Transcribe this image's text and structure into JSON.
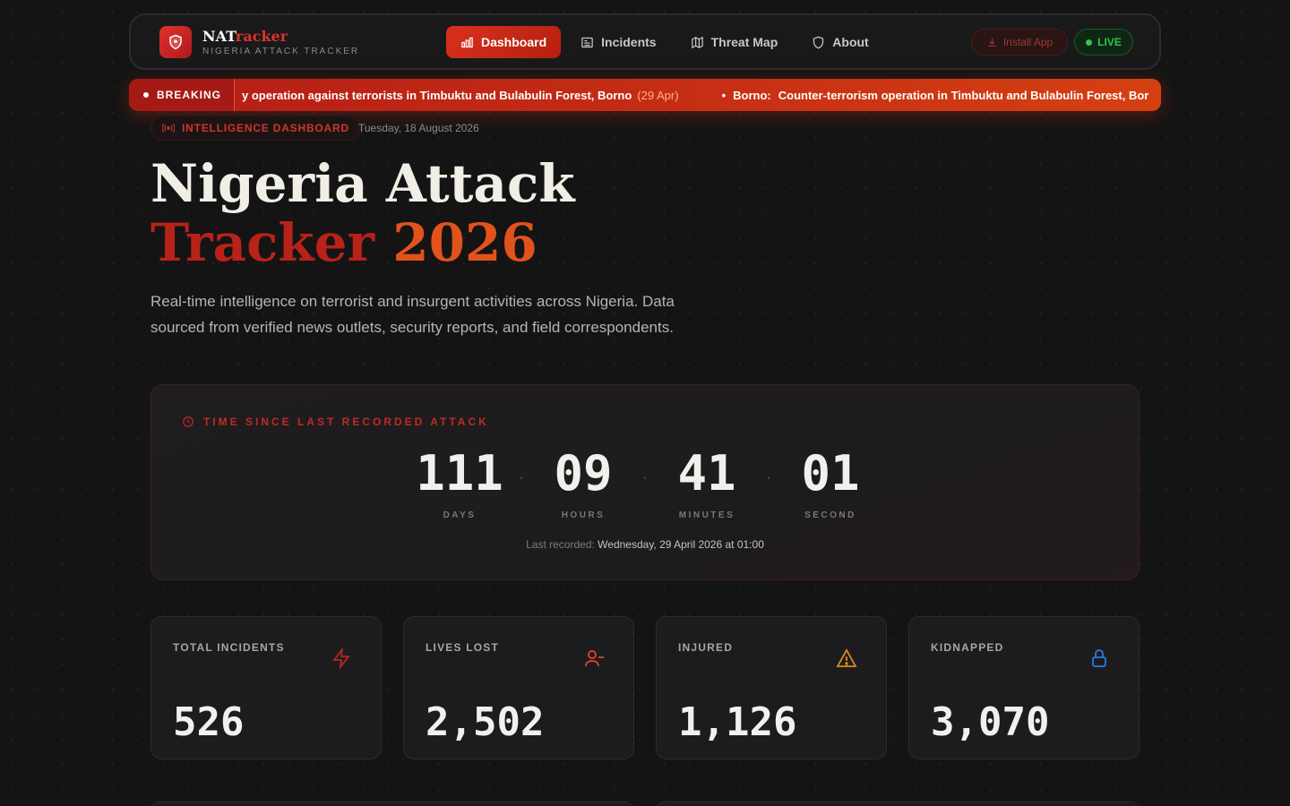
{
  "brand": {
    "name_part1": "NAT",
    "name_part2": "racker",
    "subtitle": "NIGERIA ATTACK TRACKER"
  },
  "nav": {
    "links": [
      {
        "label": "Dashboard",
        "icon": "bar-chart-icon",
        "active": true
      },
      {
        "label": "Incidents",
        "icon": "newspaper-icon",
        "active": false
      },
      {
        "label": "Threat Map",
        "icon": "map-icon",
        "active": false
      },
      {
        "label": "About",
        "icon": "shield-icon",
        "active": false
      }
    ],
    "install_label": "Install App",
    "live_label": "LIVE"
  },
  "ticker": {
    "label": "BREAKING",
    "items": [
      {
        "text": "y operation against terrorists in Timbuktu and Bulabulin Forest, Borno",
        "date": "(29 Apr)"
      },
      {
        "location": "Borno:",
        "text": "Counter-terrorism operation in Timbuktu and Bulabulin Forest, Bor"
      }
    ]
  },
  "hero": {
    "pill": "INTELLIGENCE DASHBOARD",
    "date": "Tuesday, 18 August 2026",
    "title_line1": "Nigeria Attack",
    "title_word1": "Tracker",
    "title_word2": "2026",
    "description": "Real-time intelligence on terrorist and insurgent activities across Nigeria. Data sourced from verified news outlets, security reports, and field correspondents."
  },
  "countdown": {
    "label": "TIME SINCE LAST RECORDED ATTACK",
    "units": [
      {
        "value": "111",
        "name": "DAYS"
      },
      {
        "value": "09",
        "name": "HOURS"
      },
      {
        "value": "41",
        "name": "MINUTES"
      },
      {
        "value": "01",
        "name": "SECOND"
      }
    ],
    "last_prefix": "Last recorded:",
    "last_value": "Wednesday, 29 April 2026 at 01:00"
  },
  "stats": [
    {
      "label": "TOTAL INCIDENTS",
      "value": "526",
      "icon": "lightning-icon",
      "color": "#b8261f"
    },
    {
      "label": "LIVES LOST",
      "value": "2,502",
      "icon": "user-minus-icon",
      "color": "#e0442c"
    },
    {
      "label": "INJURED",
      "value": "1,126",
      "icon": "warning-icon",
      "color": "#e08a1c"
    },
    {
      "label": "KIDNAPPED",
      "value": "3,070",
      "icon": "lock-icon",
      "color": "#2a7be0"
    }
  ],
  "colors": {
    "accent": "#d2342c",
    "live": "#31c24a",
    "background": "#141415"
  }
}
